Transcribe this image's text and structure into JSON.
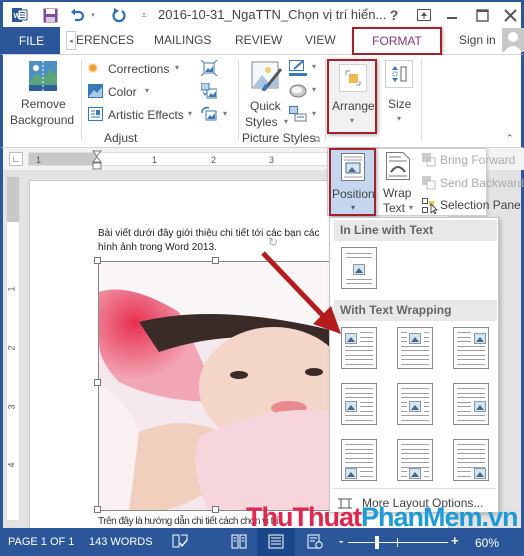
{
  "titlebar": {
    "app_icon": "word-icon",
    "quick_access": [
      "save-icon",
      "undo-icon",
      "redo-icon",
      "customize-qat-icon"
    ],
    "title": "2016-10-31_NgaTTN_Chọn vị trí hiển...",
    "controls": [
      "help-icon",
      "ribbon-display-options-icon",
      "minimize-icon",
      "maximize-icon",
      "close-icon"
    ],
    "help": "?"
  },
  "tabs": {
    "file": "FILE",
    "items": [
      "ERENCES",
      "MAILINGS",
      "REVIEW",
      "VIEW"
    ],
    "active": "FORMAT",
    "signin": "Sign in"
  },
  "ribbon": {
    "adjust": {
      "label": "Adjust",
      "remove_bg_1": "Remove",
      "remove_bg_2": "Background",
      "corrections": "Corrections",
      "color": "Color",
      "artistic": "Artistic Effects"
    },
    "picture_styles": {
      "label": "Picture Styles",
      "quick_1": "Quick",
      "quick_2": "Styles"
    },
    "arrange": "Arrange",
    "size": "Size",
    "position": "Position",
    "wrap_1": "Wrap",
    "wrap_2": "Text",
    "bring_forward": "Bring Forward",
    "send_backward": "Send Backward",
    "selection_pane": "Selection Pane"
  },
  "ruler": {
    "h_ticks": [
      "1",
      "1",
      "2",
      "3"
    ],
    "v_ticks": [
      "1",
      "2",
      "3",
      "4"
    ]
  },
  "document": {
    "line1": "Bài viết dưới đây giới thiệu chi tiết tới các bạn các",
    "line2": "hình ảnh trong Word 2013.",
    "line3": "Trên đây là hướng dẫn chi tiết cách chọn vị trí"
  },
  "position_menu": {
    "inline_header": "In Line with Text",
    "wrap_header": "With Text Wrapping",
    "wrap_options": [
      "Top Left",
      "Top Center",
      "Top Right",
      "Middle Left",
      "Middle Center",
      "Middle Right",
      "Bottom Left",
      "Bottom Center",
      "Bottom Right"
    ],
    "more": "More Layout Options..."
  },
  "statusbar": {
    "page": "PAGE 1 OF 1",
    "words": "143 WORDS",
    "zoom": "60%",
    "zoom_minus": "-",
    "zoom_plus": "+"
  },
  "watermark": {
    "part1": "ThuThuat",
    "part2": "PhanMem",
    "part3": ".vn",
    "color1": "#e0284f",
    "color2": "#1e9ad6"
  },
  "colors": {
    "word_blue": "#2b579a",
    "highlight_red": "#a2232b",
    "format_tab_text": "#8a3676"
  }
}
